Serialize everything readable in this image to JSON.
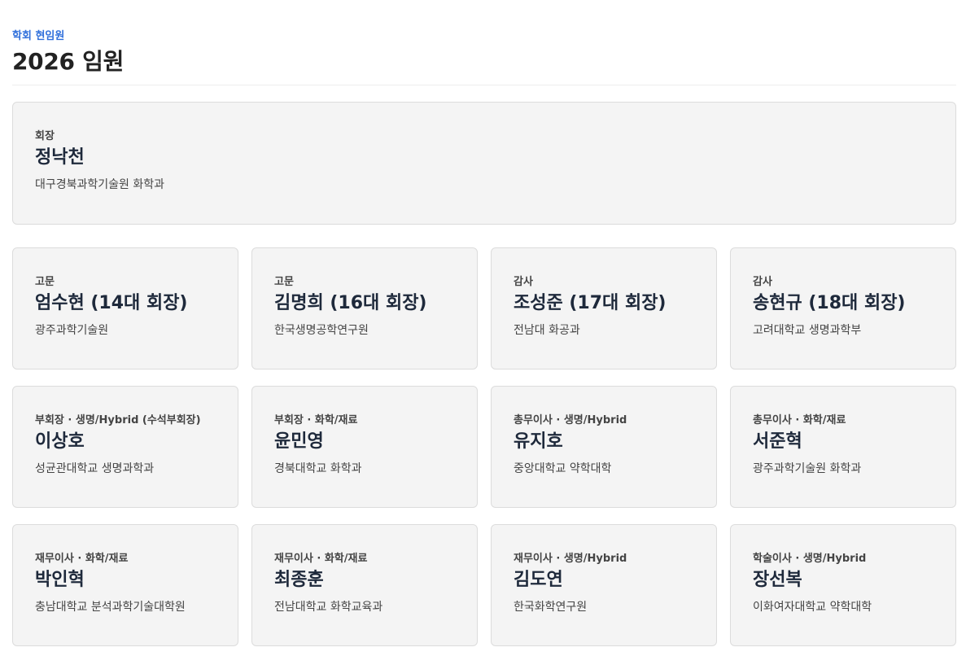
{
  "header": {
    "eyebrow": "학회 현임원",
    "title": "2026 임원"
  },
  "president": {
    "role": "회장",
    "name": "정낙천",
    "affiliation": "대구경북과학기술원 화학과"
  },
  "members": [
    {
      "role": "고문",
      "name": "엄수현 (14대 회장)",
      "affiliation": "광주과학기술원"
    },
    {
      "role": "고문",
      "name": "김명희 (16대 회장)",
      "affiliation": "한국생명공학연구원"
    },
    {
      "role": "감사",
      "name": "조성준 (17대 회장)",
      "affiliation": "전남대 화공과"
    },
    {
      "role": "감사",
      "name": "송현규 (18대 회장)",
      "affiliation": "고려대학교 생명과학부"
    },
    {
      "role": "부회장 · 생명/Hybrid (수석부회장)",
      "name": "이상호",
      "affiliation": "성균관대학교 생명과학과"
    },
    {
      "role": "부회장 · 화학/재료",
      "name": "윤민영",
      "affiliation": "경북대학교 화학과"
    },
    {
      "role": "총무이사 · 생명/Hybrid",
      "name": "유지호",
      "affiliation": "중앙대학교 약학대학"
    },
    {
      "role": "총무이사 · 화학/재료",
      "name": "서준혁",
      "affiliation": "광주과학기술원 화학과"
    },
    {
      "role": "재무이사 · 화학/재료",
      "name": "박인혁",
      "affiliation": "충남대학교 분석과학기술대학원"
    },
    {
      "role": "재무이사 · 화학/재료",
      "name": "최종훈",
      "affiliation": "전남대학교 화학교육과"
    },
    {
      "role": "재무이사 · 생명/Hybrid",
      "name": "김도연",
      "affiliation": "한국화학연구원"
    },
    {
      "role": "학술이사 · 생명/Hybrid",
      "name": "장선복",
      "affiliation": "이화여자대학교 약학대학"
    }
  ],
  "colors": {
    "accent": "#2f6fdb",
    "card_background": "#f4f4f4",
    "card_border": "#dcdcdc",
    "name_text": "#1e293b"
  }
}
